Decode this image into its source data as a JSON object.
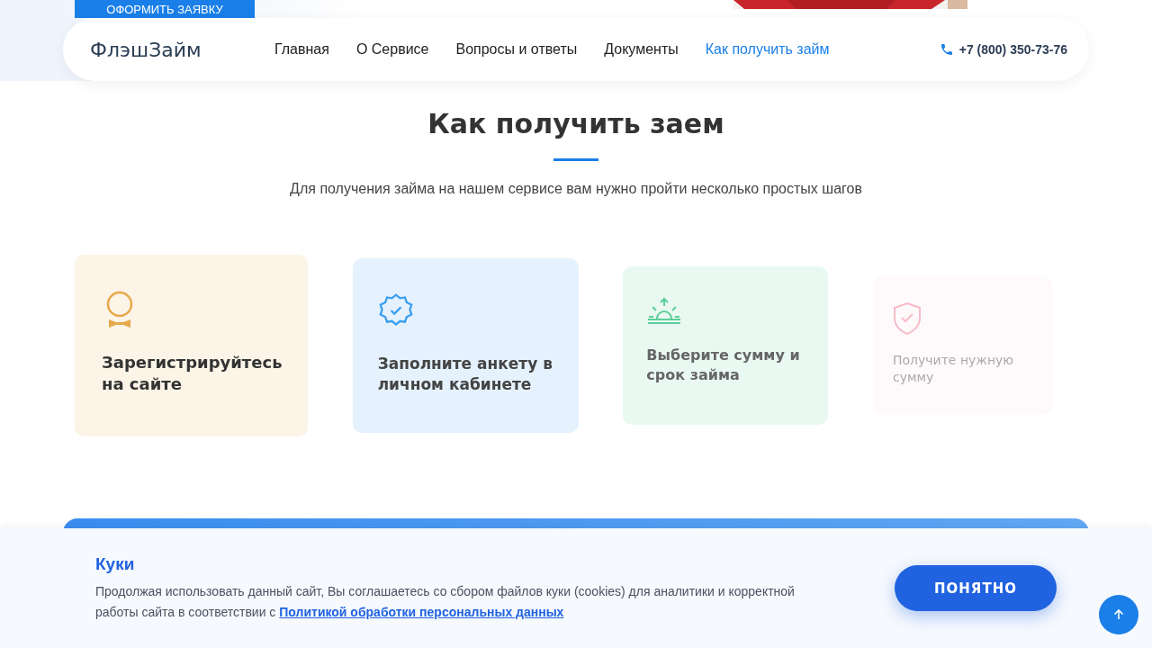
{
  "top_button": {
    "label": "ОФОРМИТЬ ЗАЯВКУ"
  },
  "header": {
    "logo": "ФлэшЗайм",
    "nav": [
      {
        "label": "Главная",
        "selected": false
      },
      {
        "label": "О Сервисе",
        "selected": false
      },
      {
        "label": "Вопросы и ответы",
        "selected": false
      },
      {
        "label": "Документы",
        "selected": false
      },
      {
        "label": "Как получить займ",
        "selected": true
      }
    ],
    "phone": "+7 (800) 350-73-76"
  },
  "section": {
    "title": "Как получить заем",
    "subtitle": "Для получения займа на нашем сервисе вам нужно пройти несколько простых шагов"
  },
  "steps": [
    {
      "kind": "medal",
      "color": "#e8a94a",
      "text": "Зарегистрируйтесь на сайте"
    },
    {
      "kind": "badge",
      "color": "#3a9ef0",
      "text": "Заполните анкету в личном кабинете"
    },
    {
      "kind": "sunrise",
      "color": "#5ccf9a",
      "text": "Выберите сумму и срок займа"
    },
    {
      "kind": "shield",
      "color": "#f6bcc8",
      "text": "Получите нужную сумму"
    }
  ],
  "cookie": {
    "title": "Куки",
    "text": "Продолжая использовать данный сайт, Вы соглашаетесь со сбором файлов куки (cookies) для аналитики и корректной работы сайта в соответствии с",
    "link": "Политикой обработки персональных данных",
    "button": "ПОНЯТНО"
  }
}
